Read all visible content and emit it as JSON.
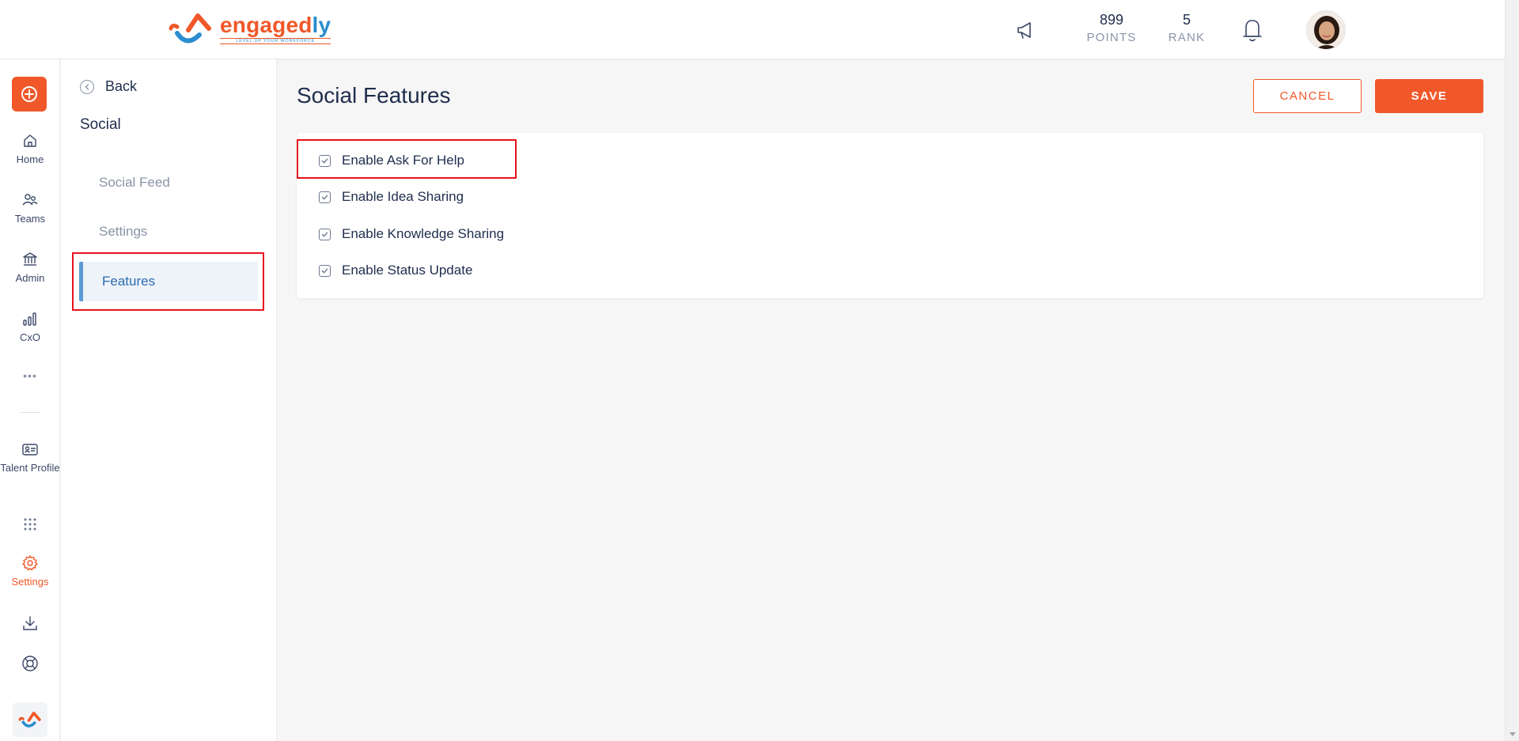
{
  "brand": {
    "name_main": "engaged",
    "name_accent": "ly",
    "tagline": "LEVEL UP YOUR WORKFORCE",
    "primary_color": "#f0582a",
    "secondary_color": "#2a8ed0"
  },
  "header": {
    "points_value": "899",
    "points_label": "POINTS",
    "rank_value": "5",
    "rank_label": "RANK",
    "icons": [
      "megaphone-icon",
      "bell-icon",
      "avatar"
    ]
  },
  "rail": {
    "items": [
      {
        "label": "Home",
        "icon": "home-icon"
      },
      {
        "label": "Teams",
        "icon": "teams-icon"
      },
      {
        "label": "Admin",
        "icon": "admin-icon"
      },
      {
        "label": "CxO",
        "icon": "chart-icon"
      },
      {
        "label": "Talent Profile",
        "icon": "id-card-icon"
      },
      {
        "label": "Settings",
        "icon": "gear-icon",
        "active": true
      }
    ],
    "more_glyph": "•••"
  },
  "subnav": {
    "back_label": "Back",
    "section_title": "Social",
    "items": [
      {
        "label": "Social Feed"
      },
      {
        "label": "Settings"
      },
      {
        "label": "Features",
        "active": true
      }
    ]
  },
  "main": {
    "title": "Social Features",
    "cancel_label": "CANCEL",
    "save_label": "SAVE",
    "options": [
      {
        "label": "Enable Ask For Help",
        "checked": true
      },
      {
        "label": "Enable Idea Sharing",
        "checked": true
      },
      {
        "label": "Enable Knowledge Sharing",
        "checked": true
      },
      {
        "label": "Enable Status Update",
        "checked": true
      }
    ]
  }
}
